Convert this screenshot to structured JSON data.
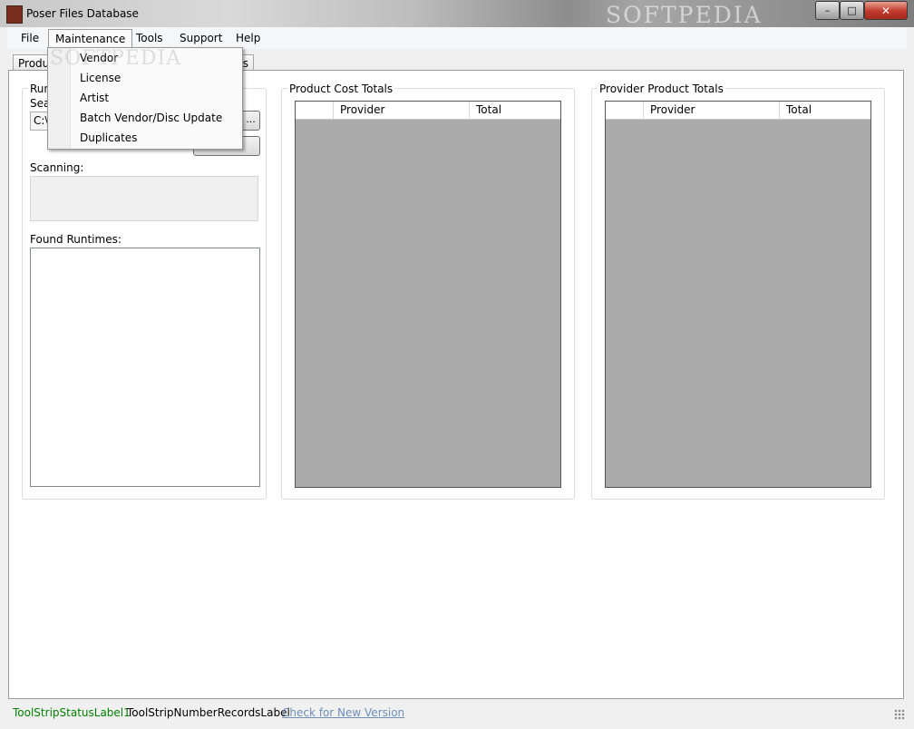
{
  "window": {
    "title": "Poser Files Database",
    "watermark": "SOFTPEDIA",
    "controls": {
      "minimize": "–",
      "maximize": "□",
      "close": "✕"
    }
  },
  "menubar": {
    "items": [
      {
        "label": "File"
      },
      {
        "label": "Maintenance"
      },
      {
        "label": "Tools"
      },
      {
        "label": "Support"
      },
      {
        "label": "Help"
      }
    ]
  },
  "maintenance_menu": {
    "items": [
      {
        "label": "Vendor"
      },
      {
        "label": "License"
      },
      {
        "label": "Artist"
      },
      {
        "label": "Batch Vendor/Disc Update"
      },
      {
        "label": "Duplicates"
      }
    ]
  },
  "tabs": [
    {
      "label": "Produc"
    },
    {
      "label": "s"
    }
  ],
  "runtime_panel": {
    "title": "Run",
    "search_label": "Sea",
    "path_value": "C:\\",
    "browse_label": "...",
    "scanning_label": "Scanning:",
    "found_label": "Found Runtimes:"
  },
  "product_cost_totals": {
    "title": "Product Cost Totals",
    "columns": [
      "Provider",
      "Total"
    ]
  },
  "provider_product_totals": {
    "title": "Provider Product Totals",
    "columns": [
      "Provider",
      "Total"
    ]
  },
  "statusbar": {
    "status_label": "ToolStripStatusLabel1",
    "records_label": "ToolStripNumberRecordsLabel",
    "update_link": "Check for New Version"
  },
  "colors": {
    "status_green": "#008000",
    "link_blue": "#6f8fb8",
    "grid_gray": "#ababab"
  }
}
